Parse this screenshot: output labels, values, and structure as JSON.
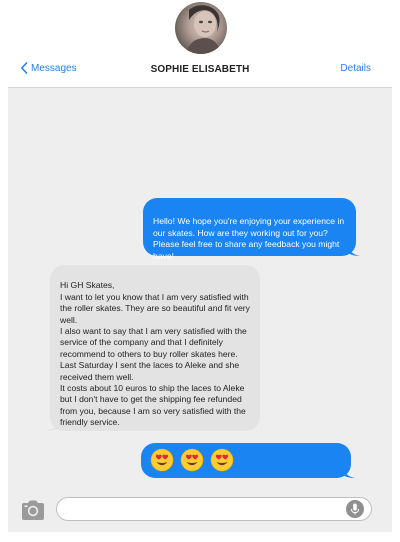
{
  "header": {
    "back_label": "Messages",
    "contact_name": "SOPHIE ELISABETH",
    "details_label": "Details"
  },
  "messages": [
    {
      "direction": "outgoing",
      "text": "Hello! We hope you're enjoying your experience in our skates. How are they working out for you? Please feel free to share any feedback you might have!"
    },
    {
      "direction": "incoming",
      "text": "Hi GH Skates,\nI want to let you know that I am very satisfied with the roller skates. They are so beautiful and fit very well.\nI also want to say that I am very satisfied with the service of the company and that I definitely recommend to others to buy roller skates here.\nLast Saturday I sent the laces to Aleke and she received them well.\nIt costs about 10 euros to ship the laces to Aleke but I don't have to get the shipping fee refunded from you, because I am so very satisfied with the friendly service."
    },
    {
      "direction": "outgoing",
      "emojis": [
        "heart-eyes-emoji",
        "heart-eyes-emoji",
        "heart-eyes-emoji"
      ]
    }
  ],
  "composer": {
    "value": "",
    "placeholder": "",
    "camera_icon": "camera-icon",
    "mic_icon": "microphone-icon"
  },
  "colors": {
    "accent": "#2b7de9",
    "outgoing_bubble": "#1a85f2",
    "incoming_bubble": "#e3e3e3",
    "chat_background": "#eeeeee"
  }
}
